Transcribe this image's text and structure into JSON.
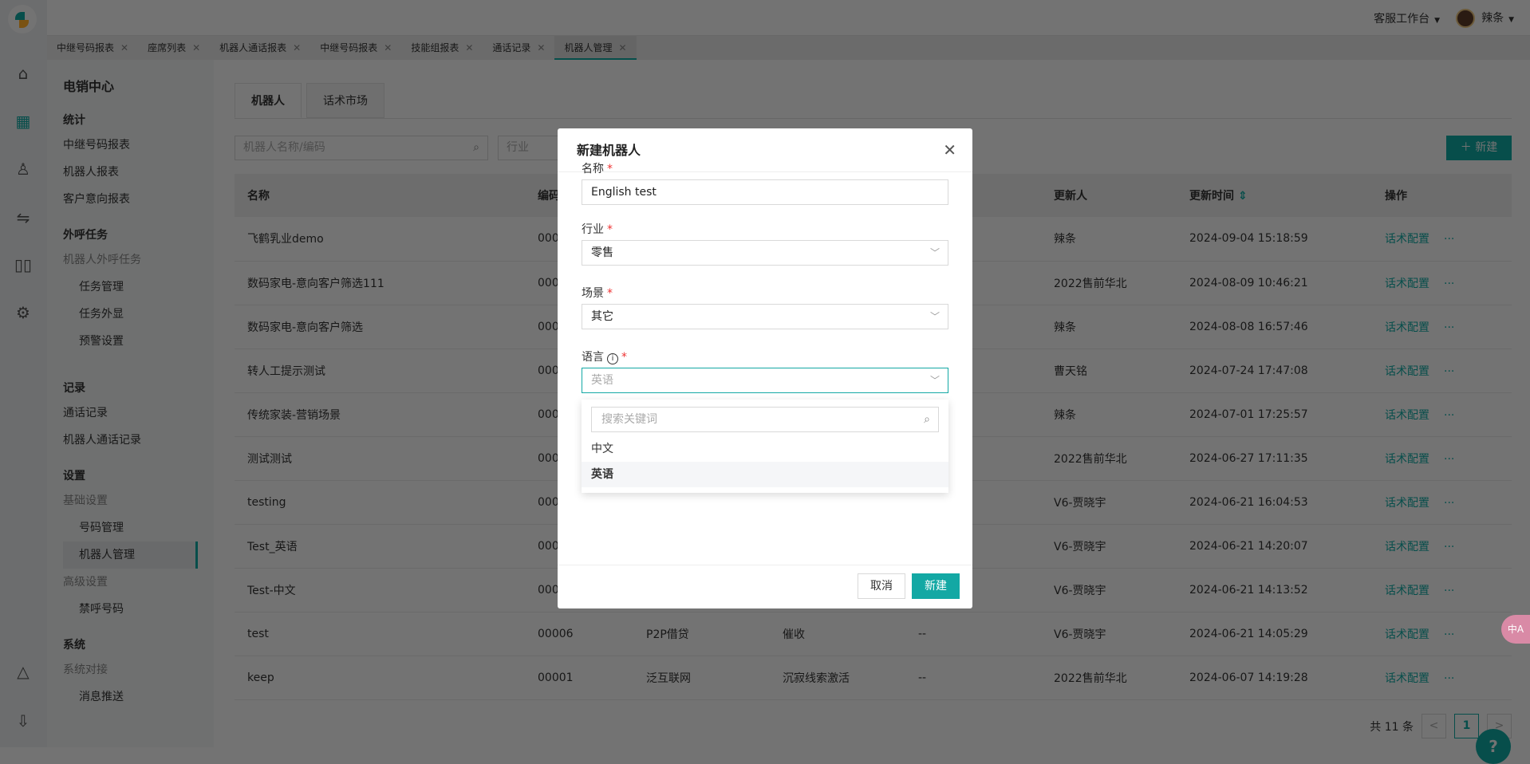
{
  "header": {
    "workspace": "客服工作台",
    "user": "辣条"
  },
  "tabs": [
    "中继号码报表",
    "座席列表",
    "机器人通话报表",
    "中继号码报表",
    "技能组报表",
    "通话记录",
    "机器人管理"
  ],
  "sidebar": {
    "title": "电销中心",
    "items": [
      {
        "label": "统计",
        "type": "group"
      },
      {
        "label": "中继号码报表",
        "type": "item"
      },
      {
        "label": "机器人报表",
        "type": "item"
      },
      {
        "label": "客户意向报表",
        "type": "item"
      },
      {
        "type": "gap"
      },
      {
        "label": "外呼任务",
        "type": "group"
      },
      {
        "label": "机器人外呼任务",
        "type": "sub"
      },
      {
        "label": "任务管理",
        "type": "ind"
      },
      {
        "label": "任务外显",
        "type": "ind"
      },
      {
        "label": "预警设置",
        "type": "ind"
      },
      {
        "type": "gap"
      },
      {
        "type": "gap"
      },
      {
        "label": "记录",
        "type": "group"
      },
      {
        "label": "通话记录",
        "type": "item"
      },
      {
        "label": "机器人通话记录",
        "type": "item"
      },
      {
        "type": "gap"
      },
      {
        "label": "设置",
        "type": "group"
      },
      {
        "label": "基础设置",
        "type": "sub"
      },
      {
        "label": "号码管理",
        "type": "ind"
      },
      {
        "label": "机器人管理",
        "type": "ind active"
      },
      {
        "label": "高级设置",
        "type": "sub"
      },
      {
        "label": "禁呼号码",
        "type": "ind"
      },
      {
        "type": "gap"
      },
      {
        "label": "系统",
        "type": "group"
      },
      {
        "label": "系统对接",
        "type": "sub"
      },
      {
        "label": "消息推送",
        "type": "ind"
      }
    ]
  },
  "page_tabs": [
    "机器人",
    "话术市场"
  ],
  "search": {
    "placeholder": "机器人名称/编码",
    "industry_placeholder": "行业"
  },
  "new_button": "新建",
  "table": {
    "headers": [
      "名称",
      "编码",
      "",
      "",
      "",
      "更新人",
      "更新时间",
      "操作"
    ],
    "op_label": "话术配置",
    "more": "···",
    "rows": [
      [
        "飞鹤乳业demo",
        "000",
        "",
        "",
        "",
        "辣条",
        "2024-09-04 15:18:59"
      ],
      [
        "数码家电-意向客户筛选111",
        "000",
        "",
        "",
        "",
        "2022售前华北",
        "2024-08-09 10:46:21"
      ],
      [
        "数码家电-意向客户筛选",
        "000",
        "",
        "",
        "",
        "辣条",
        "2024-08-08 16:57:46"
      ],
      [
        "转人工提示测试",
        "000",
        "",
        "",
        "",
        "曹天铭",
        "2024-07-24 17:47:08"
      ],
      [
        "传统家装-营销场景",
        "000",
        "",
        "",
        "",
        "辣条",
        "2024-07-01 17:25:57"
      ],
      [
        "测试测试",
        "000",
        "",
        "",
        "",
        "2022售前华北",
        "2024-06-27 17:11:35"
      ],
      [
        "testing",
        "000",
        "",
        "",
        "",
        "V6-贾晓宇",
        "2024-06-21 16:04:53"
      ],
      [
        "Test_英语",
        "000",
        "",
        "",
        "",
        "V6-贾晓宇",
        "2024-06-21 14:20:07"
      ],
      [
        "Test-中文",
        "000",
        "",
        "",
        "",
        "V6-贾晓宇",
        "2024-06-21 14:13:52"
      ],
      [
        "test",
        "00006",
        "P2P借贷",
        "催收",
        "--",
        "V6-贾晓宇",
        "2024-06-21 14:05:29"
      ],
      [
        "keep",
        "00001",
        "泛互联网",
        "沉寂线索激活",
        "--",
        "2022售前华北",
        "2024-06-07 14:19:28"
      ]
    ]
  },
  "pagination": {
    "total": "共 11 条",
    "current": "1",
    "prev": "<",
    "next": ">"
  },
  "modal": {
    "title": "新建机器人",
    "name_label": "名称",
    "name_value": "English test",
    "industry_label": "行业",
    "industry_value": "零售",
    "scene_label": "场景",
    "scene_value": "其它",
    "language_label": "语言",
    "language_value": "英语",
    "dropdown_search_placeholder": "搜索关键词",
    "options": [
      "中文",
      "英语"
    ],
    "selected_option": "英语",
    "cancel": "取消",
    "ok": "新建"
  },
  "colors": {
    "accent": "#0f8a85",
    "primary_button": "#13a8a4",
    "required": "#e33"
  }
}
